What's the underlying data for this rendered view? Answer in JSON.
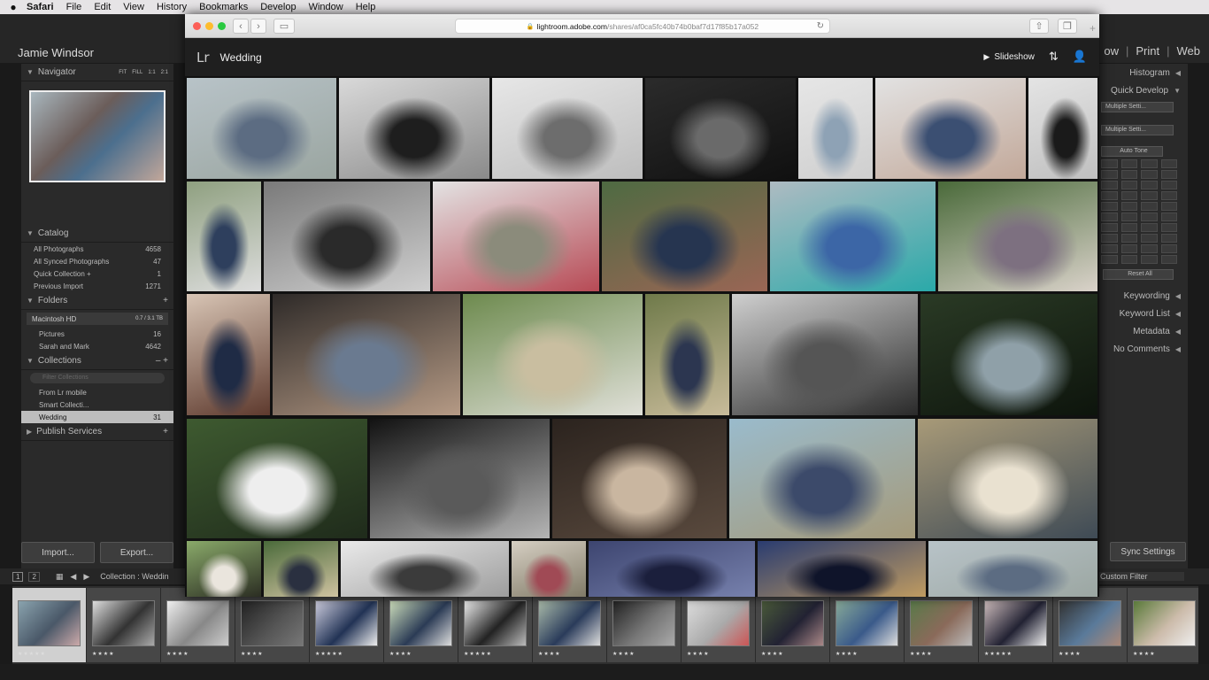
{
  "menubar": {
    "apple": "",
    "items": [
      {
        "label": "Safari",
        "bold": true
      },
      {
        "label": "File"
      },
      {
        "label": "Edit"
      },
      {
        "label": "View"
      },
      {
        "label": "History"
      },
      {
        "label": "Bookmarks"
      },
      {
        "label": "Develop"
      },
      {
        "label": "Window"
      },
      {
        "label": "Help"
      }
    ]
  },
  "lrc": {
    "identity": "Jamie Windsor",
    "modules": [
      "ow",
      "Print",
      "Web"
    ],
    "navigator": {
      "title": "Navigator",
      "zoom": [
        "FIT",
        "FILL",
        "1:1",
        "2:1"
      ]
    },
    "catalog": {
      "title": "Catalog",
      "items": [
        {
          "label": "All Photographs",
          "count": "4658"
        },
        {
          "label": "All Synced Photographs",
          "count": "47"
        },
        {
          "label": "Quick Collection +",
          "count": "1"
        },
        {
          "label": "Previous Import",
          "count": "1271"
        }
      ]
    },
    "folders": {
      "title": "Folders",
      "drive": {
        "label": "Macintosh HD",
        "size": "0.7 / 3.1 TB"
      },
      "items": [
        {
          "label": "Pictures",
          "count": "16"
        },
        {
          "label": "Sarah and Mark",
          "count": "4642"
        }
      ]
    },
    "collections": {
      "title": "Collections",
      "filter_placeholder": "Filter Collections",
      "items": [
        {
          "label": "From Lr mobile",
          "count": ""
        },
        {
          "label": "Smart Collecti...",
          "count": ""
        },
        {
          "label": "Wedding",
          "count": "31"
        }
      ]
    },
    "publish": {
      "title": "Publish Services"
    },
    "import_label": "Import...",
    "export_label": "Export...",
    "right": {
      "histogram": "Histogram",
      "quick_develop": "Quick Develop",
      "preset1": "Multiple Setti...",
      "preset2": "Multiple Setti...",
      "auto_tone": "Auto Tone",
      "reset_all": "Reset All",
      "keywording": "Keywording",
      "keyword_list": "Keyword List",
      "metadata": "Metadata",
      "comments": "No Comments"
    },
    "sync_label": "Sync Settings",
    "toolbar": {
      "page1": "1",
      "page2": "2",
      "source": "Collection : Weddin",
      "filter": "Custom Filter"
    },
    "filmstrip_colors": [
      [
        "#8aa3ae",
        "#4a5868",
        "#caa"
      ],
      [
        "#ddd",
        "#333",
        "#aaa"
      ],
      [
        "#eee",
        "#888",
        "#ccc"
      ],
      [
        "#222",
        "#555",
        "#777"
      ],
      [
        "#ccd",
        "#223355",
        "#eee"
      ],
      [
        "#cdb",
        "#2b3b55",
        "#ddd"
      ],
      [
        "#eee",
        "#222",
        "#bbb"
      ],
      [
        "#aba",
        "#2a3b5a",
        "#ddd"
      ],
      [
        "#222",
        "#777",
        "#aaa"
      ],
      [
        "#ddd",
        "#aaa",
        "#c55"
      ],
      [
        "#4a5a3a",
        "#223",
        "#a88"
      ],
      [
        "#8a9",
        "#3a5a8a",
        "#ddd"
      ],
      [
        "#5a7a4a",
        "#8a6a5a",
        "#bbb"
      ],
      [
        "#cbb",
        "#223",
        "#eee"
      ],
      [
        "#333",
        "#5a7a9a",
        "#a87"
      ],
      [
        "#5a7a3a",
        "#cba",
        "#eee"
      ]
    ],
    "filmstrip_stars": [
      "★★★★★",
      "★★★★",
      "★★★★",
      "★★★★",
      "★★★★★",
      "★★★★",
      "★★★★★",
      "★★★★",
      "★★★★",
      "★★★★",
      "★★★★",
      "★★★★",
      "★★★★",
      "★★★★★",
      "★★★★",
      "★★★★"
    ]
  },
  "safari": {
    "url_domain": "lightroom.adobe.com",
    "url_path": "/shares/af0ca5fc40b74b0baf7d17f85b17a052",
    "lr_logo": "Lr",
    "album_title": "Wedding",
    "slideshow_label": "Slideshow",
    "photos": [
      {
        "a": "#b8c3c8",
        "b": "#5c6c82",
        "c": "#9aa5a0"
      },
      {
        "a": "#d9d9d9",
        "b": "#1e1e1e",
        "c": "#8a8a8a"
      },
      {
        "a": "#e7e7e7",
        "b": "#6d6d6d",
        "c": "#bdbdbd"
      },
      {
        "a": "#2b2b2b",
        "b": "#6a6a6a",
        "c": "#101010"
      },
      {
        "a": "#e6e6e6",
        "b": "#8ea2b5",
        "c": "#cfcfcf"
      },
      {
        "a": "#e2e2e2",
        "b": "#3b4f72",
        "c": "#c2a899"
      },
      {
        "a": "#e4e4e4",
        "b": "#1a1a1a",
        "c": "#bfbfbf"
      },
      {
        "a": "#8fa080",
        "b": "#2e3f5d",
        "c": "#dddddd"
      },
      {
        "a": "#7a7a7a",
        "b": "#2a2a2a",
        "c": "#cfcfcf"
      },
      {
        "a": "#e3e3e3",
        "b": "#8b8b7b",
        "c": "#b74a55"
      },
      {
        "a": "#4e6a42",
        "b": "#263550",
        "c": "#9a6655"
      },
      {
        "a": "#aebbc2",
        "b": "#3c66a6",
        "c": "#2aa9a9"
      },
      {
        "a": "#4a6a3a",
        "b": "#7d7080",
        "c": "#dcd4cc"
      },
      {
        "a": "#d8c5b5",
        "b": "#1f2b45",
        "c": "#5e3a2e"
      },
      {
        "a": "#2e2a28",
        "b": "#6a7a90",
        "c": "#b59a85"
      },
      {
        "a": "#6d8a4e",
        "b": "#c9bea0",
        "c": "#e0e0d8"
      },
      {
        "a": "#6f7a4a",
        "b": "#2c3650",
        "c": "#c8bb9a"
      },
      {
        "a": "#cfcfcf",
        "b": "#555555",
        "c": "#2a2a2a"
      },
      {
        "a": "#2a3a25",
        "b": "#8fa0a8",
        "c": "#0d140c"
      },
      {
        "a": "#3e5a30",
        "b": "#eeeeee",
        "c": "#1f2b1b"
      },
      {
        "a": "#121212",
        "b": "#5a5a5a",
        "c": "#b5b5b5"
      },
      {
        "a": "#2b231e",
        "b": "#c9b6a0",
        "c": "#5a4a3e"
      },
      {
        "a": "#9abbcc",
        "b": "#3c4a6a",
        "c": "#a59a7a"
      },
      {
        "a": "#a89a78",
        "b": "#e9e1d0",
        "c": "#3e4a55"
      },
      {
        "a": "#8aaa6a",
        "b": "#eae5dd",
        "c": "#24241d"
      },
      {
        "a": "#4a6a3a",
        "b": "#2a3040",
        "c": "#d9c9a8"
      },
      {
        "a": "#eaeaea",
        "b": "#3b3b3b",
        "c": "#999999"
      },
      {
        "a": "#d6cfc3",
        "b": "#a04a55",
        "c": "#7a7460"
      },
      {
        "a": "#3d4570",
        "b": "#1b1f3c",
        "c": "#7a84b0"
      },
      {
        "a": "#2a3c70",
        "b": "#0f142a",
        "c": "#c7a060"
      }
    ]
  }
}
